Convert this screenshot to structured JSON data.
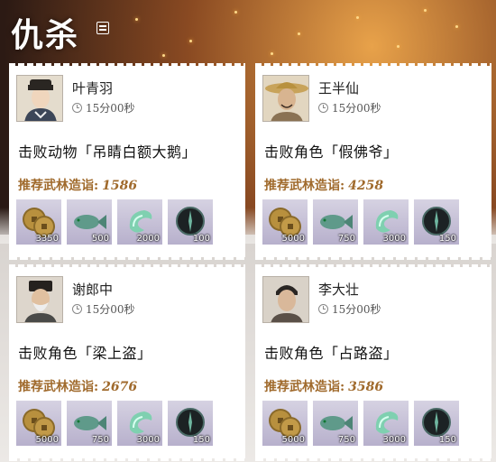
{
  "page": {
    "title": "仇杀",
    "menu_icon": "list-icon"
  },
  "cards": [
    {
      "name": "叶青羽",
      "time": "15分00秒",
      "target": "击败动物「吊睛白额大鹅」",
      "rec_label": "推荐武林造诣:",
      "rec_value": "1586",
      "rewards": [
        {
          "icon": "copper-coins-icon",
          "qty": "3350"
        },
        {
          "icon": "fish-icon",
          "qty": "500"
        },
        {
          "icon": "jade-swirl-icon",
          "qty": "2000"
        },
        {
          "icon": "dark-orb-icon",
          "qty": "100"
        }
      ]
    },
    {
      "name": "王半仙",
      "time": "15分00秒",
      "target": "击败角色「假佛爷」",
      "rec_label": "推荐武林造诣:",
      "rec_value": "4258",
      "rewards": [
        {
          "icon": "copper-coins-icon",
          "qty": "5000"
        },
        {
          "icon": "fish-icon",
          "qty": "750"
        },
        {
          "icon": "jade-swirl-icon",
          "qty": "3000"
        },
        {
          "icon": "dark-orb-icon",
          "qty": "150"
        }
      ]
    },
    {
      "name": "谢郎中",
      "time": "15分00秒",
      "target": "击败角色「梁上盗」",
      "rec_label": "推荐武林造诣:",
      "rec_value": "2676",
      "rewards": [
        {
          "icon": "copper-coins-icon",
          "qty": "5000"
        },
        {
          "icon": "fish-icon",
          "qty": "750"
        },
        {
          "icon": "jade-swirl-icon",
          "qty": "3000"
        },
        {
          "icon": "dark-orb-icon",
          "qty": "150"
        }
      ]
    },
    {
      "name": "李大壮",
      "time": "15分00秒",
      "target": "击败角色「占路盗」",
      "rec_label": "推荐武林造诣:",
      "rec_value": "3586",
      "rewards": [
        {
          "icon": "copper-coins-icon",
          "qty": "5000"
        },
        {
          "icon": "fish-icon",
          "qty": "750"
        },
        {
          "icon": "jade-swirl-icon",
          "qty": "3000"
        },
        {
          "icon": "dark-orb-icon",
          "qty": "150"
        }
      ]
    }
  ],
  "colors": {
    "accent": "#a06a2c",
    "reward_bg": "#c6c0d8"
  }
}
